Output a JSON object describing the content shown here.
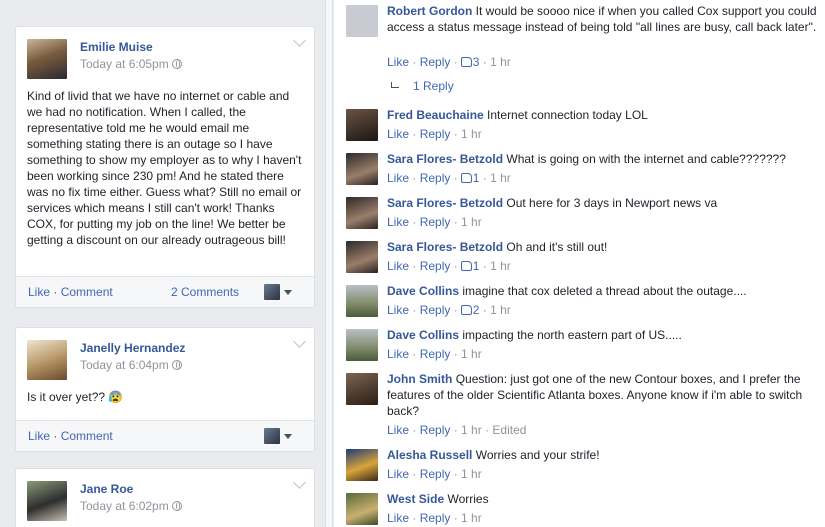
{
  "posts": [
    {
      "author": "Emilie Muise",
      "time": "Today at 6:05pm",
      "body": "Kind of livid that we have no internet or cable and we had no notification. When I called, the representative told me he would email me something stating there is an outage so I have something to show my employer as to why I haven't been working since 230 pm! And he stated there was no fix time either. Guess what? Still no email or services which means I still can't work! Thanks COX, for putting my job on the line! We better be getting a discount on our already outrageous bill!",
      "like": "Like",
      "sep": " · ",
      "comment": "Comment",
      "comments_count": "2 Comments"
    },
    {
      "author": "Janelly Hernandez",
      "time": "Today at 6:04pm",
      "body": "Is it over yet?? 😰",
      "like": "Like",
      "sep": " · ",
      "comment": "Comment"
    },
    {
      "author": "Jane Roe",
      "time": "Today at 6:02pm"
    }
  ],
  "comments": [
    {
      "name": "Robert Gordon",
      "text": "It would be soooo nice if when you called Cox support you could access a status message instead of being told \"all lines are busy, call back later\".",
      "like": "Like",
      "reply": "Reply",
      "likes": "3",
      "time": "1 hr",
      "replies_label": "1 Reply"
    },
    {
      "name": "Fred Beauchaine",
      "text": "Internet connection today LOL",
      "like": "Like",
      "reply": "Reply",
      "time": "1 hr"
    },
    {
      "name": "Sara Flores- Betzold",
      "text": "What is going on with the internet and cable???????",
      "like": "Like",
      "reply": "Reply",
      "likes": "1",
      "time": "1 hr"
    },
    {
      "name": "Sara Flores- Betzold",
      "text": "Out here for 3 days in Newport news va",
      "like": "Like",
      "reply": "Reply",
      "time": "1 hr"
    },
    {
      "name": "Sara Flores- Betzold",
      "text": "Oh and it's still out!",
      "like": "Like",
      "reply": "Reply",
      "likes": "1",
      "time": "1 hr"
    },
    {
      "name": "Dave Collins",
      "text": "imagine that cox deleted a thread about the outage....",
      "like": "Like",
      "reply": "Reply",
      "likes": "2",
      "time": "1 hr"
    },
    {
      "name": "Dave Collins",
      "text": "impacting the north eastern part of US.....",
      "like": "Like",
      "reply": "Reply",
      "time": "1 hr"
    },
    {
      "name": "John Smith",
      "text": "Question: just got one of the new Contour boxes, and I prefer the features of the older Scientific Atlanta boxes. Anyone know if i'm able to switch back?",
      "like": "Like",
      "reply": "Reply",
      "time": "1 hr",
      "edited": "Edited"
    },
    {
      "name": "Alesha Russell",
      "text": "Worries and your strife!",
      "like": "Like",
      "reply": "Reply",
      "time": "1 hr"
    },
    {
      "name": "West Side",
      "text": "Worries",
      "like": "Like",
      "reply": "Reply",
      "time": "1 hr"
    }
  ]
}
